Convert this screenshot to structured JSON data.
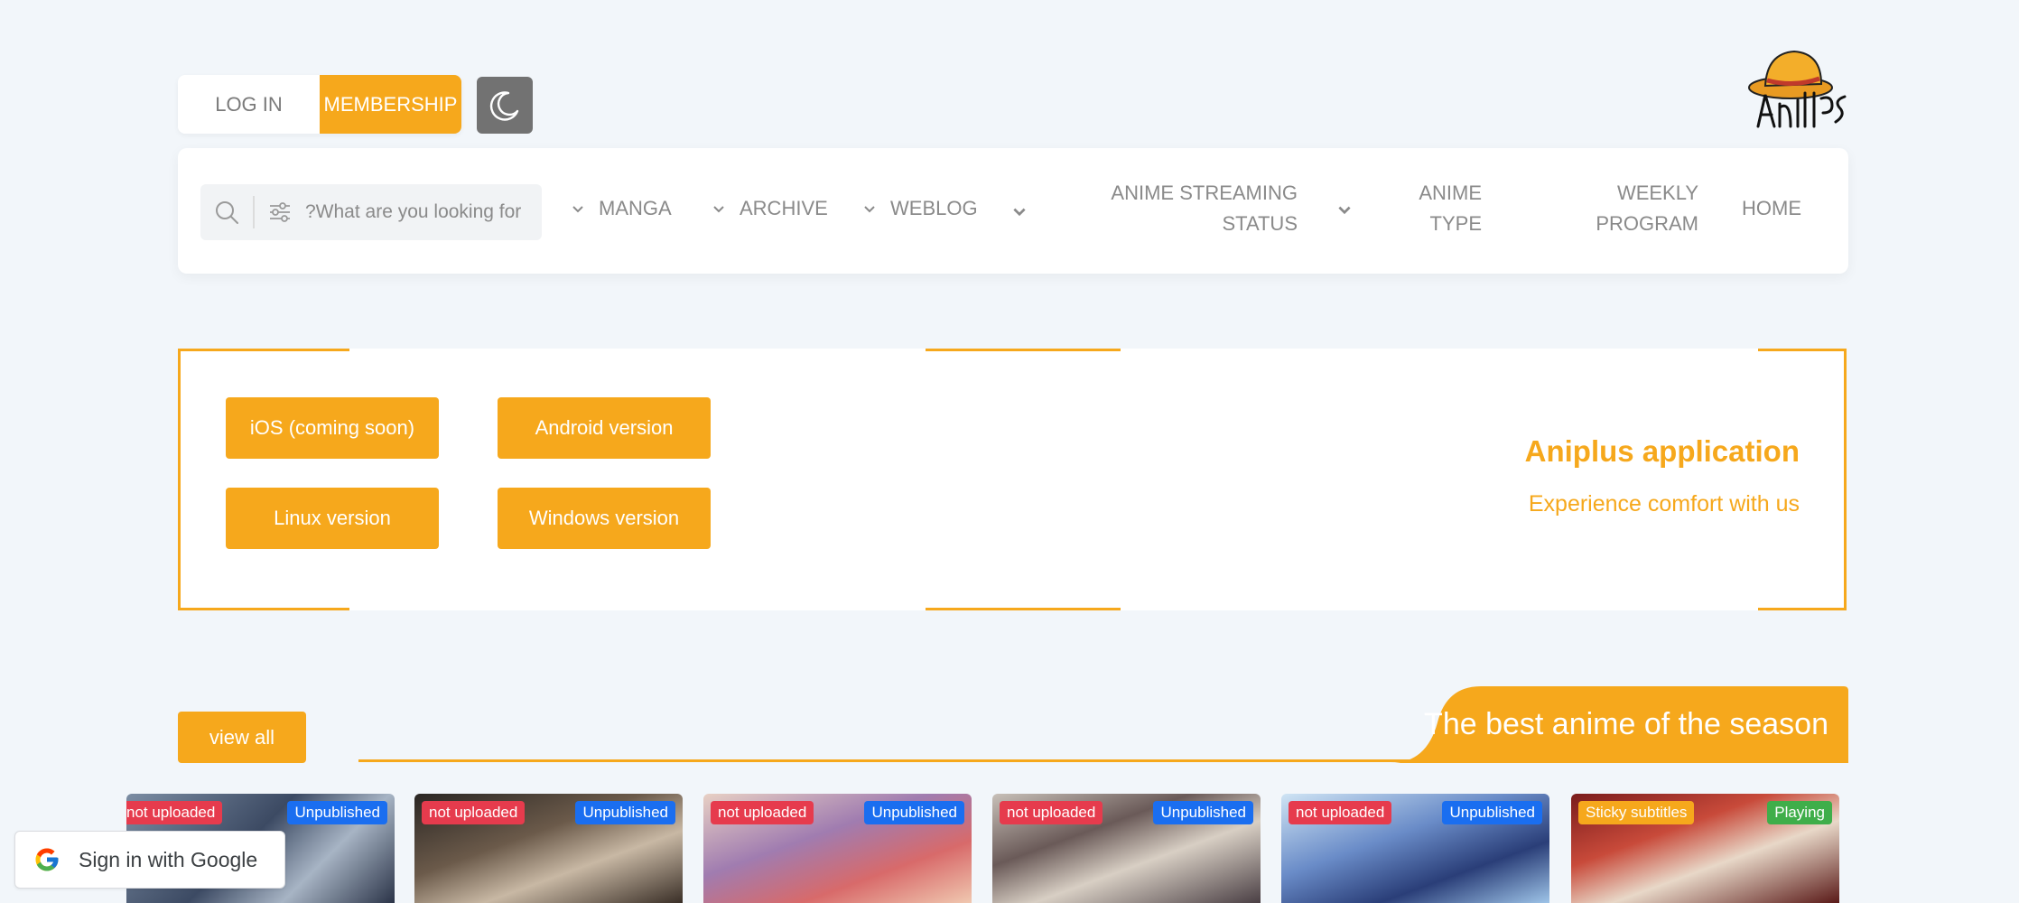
{
  "auth": {
    "login_label": "LOG IN",
    "membership_label": "MEMBERSHIP"
  },
  "theme_toggle": {
    "icon": "moon-icon"
  },
  "logo": {
    "text": "Aniplus"
  },
  "search": {
    "placeholder": "?What are you looking for",
    "icon": "search-icon",
    "filter_icon": "sliders-icon"
  },
  "nav": {
    "items": [
      {
        "label": "MANGA",
        "has_dropdown": true
      },
      {
        "label": "ARCHIVE",
        "has_dropdown": true
      },
      {
        "label": "WEBLOG",
        "has_dropdown": true
      },
      {
        "label_lines": [
          "ANIME STREAMING",
          "STATUS"
        ],
        "has_dropdown": true
      },
      {
        "label_lines": [
          "ANIME",
          "TYPE"
        ],
        "has_dropdown": true
      },
      {
        "label_lines": [
          "WEEKLY",
          "PROGRAM"
        ],
        "has_dropdown": false
      },
      {
        "label": "HOME",
        "has_dropdown": false
      }
    ]
  },
  "app_banner": {
    "title": "Aniplus application",
    "subtitle": "Experience comfort with us",
    "buttons": [
      "iOS (coming soon)",
      "Android version",
      "Linux version",
      "Windows version"
    ]
  },
  "section": {
    "title": "The best anime of the season",
    "view_all": "view all"
  },
  "cards": [
    {
      "left_badge": "not uploaded",
      "right_badge": "Unpublished",
      "left_color": "#e63b4d",
      "right_color": "#1a6ef0"
    },
    {
      "left_badge": "not uploaded",
      "right_badge": "Unpublished",
      "left_color": "#e63b4d",
      "right_color": "#1a6ef0"
    },
    {
      "left_badge": "not uploaded",
      "right_badge": "Unpublished",
      "left_color": "#e63b4d",
      "right_color": "#1a6ef0"
    },
    {
      "left_badge": "not uploaded",
      "right_badge": "Unpublished",
      "left_color": "#e63b4d",
      "right_color": "#1a6ef0"
    },
    {
      "left_badge": "not uploaded",
      "right_badge": "Unpublished",
      "left_color": "#e63b4d",
      "right_color": "#1a6ef0"
    },
    {
      "left_badge": "Sticky subtitles",
      "right_badge": "Playing",
      "left_color": "#f6a81c",
      "right_color": "#3fae4a"
    }
  ],
  "google": {
    "label": "Sign in with Google"
  },
  "colors": {
    "accent": "#f6a81c",
    "background": "#f2f6fa"
  }
}
